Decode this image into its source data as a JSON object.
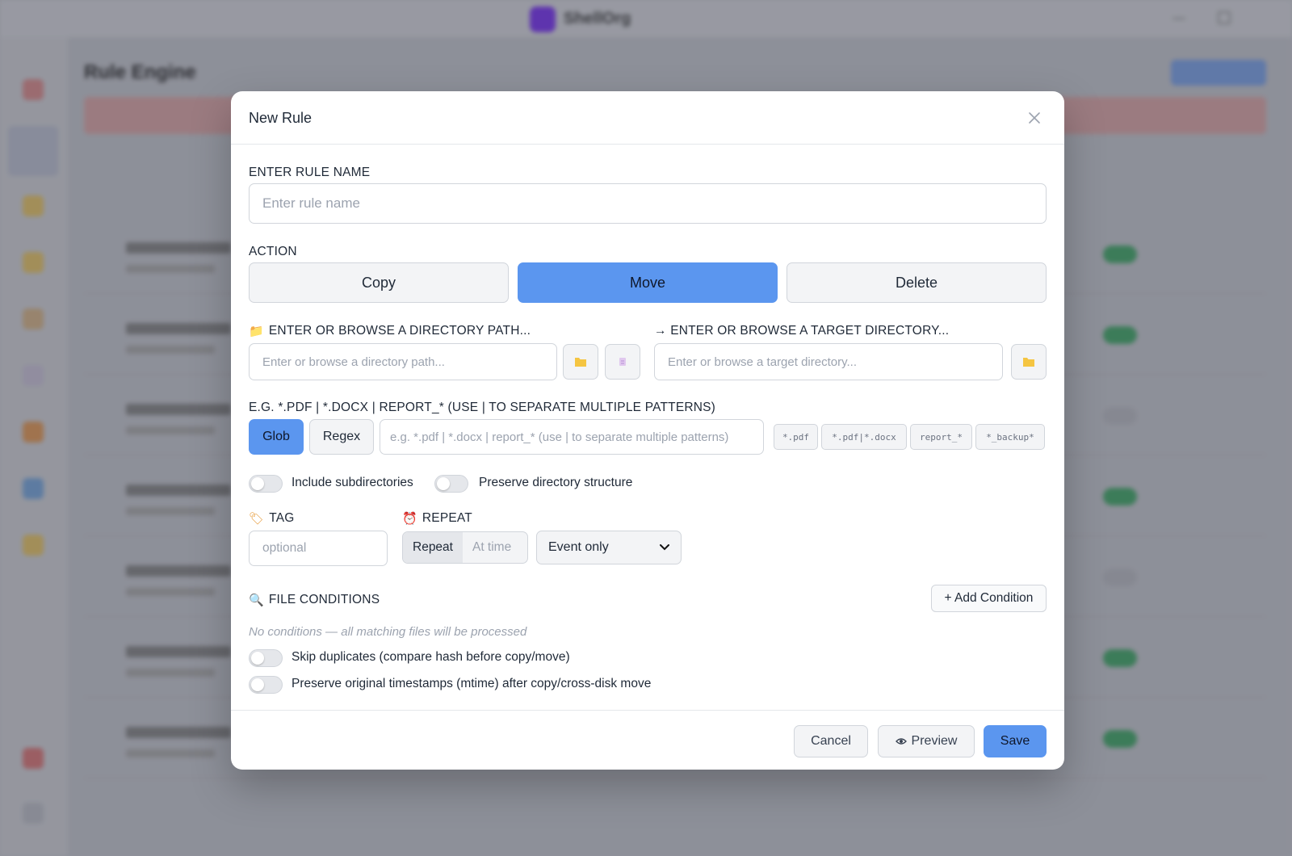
{
  "background": {
    "app_name": "ShellOrg",
    "heading": "Rule Engine"
  },
  "modal": {
    "title": "New Rule",
    "rule_name": {
      "label": "ENTER RULE NAME",
      "placeholder": "Enter rule name",
      "value": ""
    },
    "action": {
      "label": "ACTION",
      "options": [
        "Copy",
        "Move",
        "Delete"
      ],
      "selected": "Move"
    },
    "source": {
      "label": "ENTER OR BROWSE A DIRECTORY PATH...",
      "placeholder": "Enter or browse a directory path..."
    },
    "target": {
      "label": "→ ENTER OR BROWSE A TARGET DIRECTORY...",
      "placeholder": "Enter or browse a target directory..."
    },
    "pattern": {
      "label": "E.G. *.PDF | *.DOCX | REPORT_* (USE | TO SEPARATE MULTIPLE PATTERNS)",
      "modes": [
        "Glob",
        "Regex"
      ],
      "selected_mode": "Glob",
      "placeholder": "e.g. *.pdf | *.docx | report_* (use | to separate multiple patterns)",
      "presets": [
        "*.pdf",
        "*.pdf|*.docx",
        "report_*",
        "*_backup*"
      ]
    },
    "options": {
      "include_subdirectories": "Include subdirectories",
      "preserve_structure": "Preserve directory structure"
    },
    "tag": {
      "label": "TAG",
      "placeholder": "optional"
    },
    "repeat": {
      "label": "REPEAT",
      "modes": [
        "Repeat",
        "At time"
      ],
      "selected_mode": "Repeat",
      "schedule_value": "Event only"
    },
    "conditions": {
      "label": "FILE CONDITIONS",
      "add_label": "+ Add Condition",
      "empty_hint": "No conditions — all matching files will be processed"
    },
    "skip_duplicates": "Skip duplicates (compare hash before copy/move)",
    "preserve_timestamps": "Preserve original timestamps (mtime) after copy/cross-disk move",
    "footer": {
      "cancel": "Cancel",
      "preview": "Preview",
      "save": "Save"
    }
  },
  "colors": {
    "accent": "#5b96ef",
    "folder": "#f5c542"
  }
}
